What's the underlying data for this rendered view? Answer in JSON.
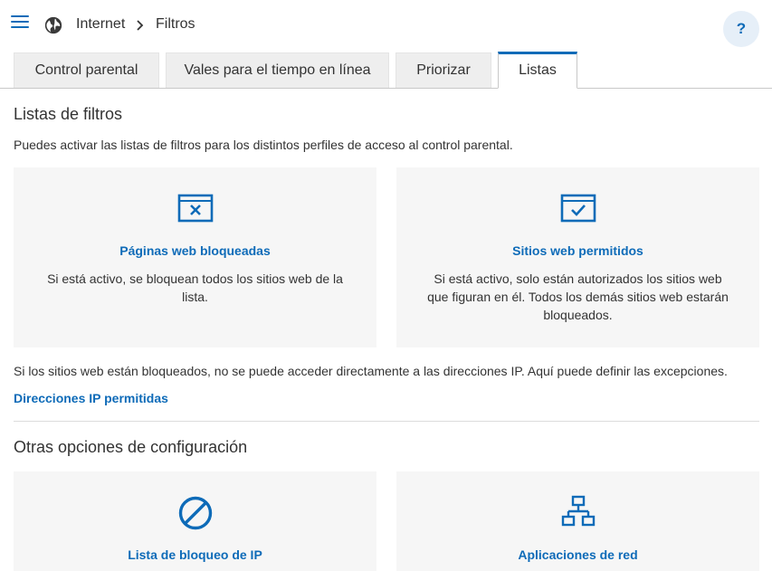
{
  "breadcrumb": {
    "parent": "Internet",
    "current": "Filtros"
  },
  "help": {
    "label": "?"
  },
  "tabs": [
    {
      "label": "Control parental"
    },
    {
      "label": "Vales para el tiempo en línea"
    },
    {
      "label": "Priorizar"
    },
    {
      "label": "Listas"
    }
  ],
  "filters": {
    "title": "Listas de filtros",
    "description": "Puedes activar las listas de filtros para los distintos perfiles de acceso al control parental.",
    "cards": [
      {
        "icon": "blocked-window-icon",
        "title": "Páginas web bloqueadas",
        "description": "Si está activo, se bloquean todos los sitios web de la lista."
      },
      {
        "icon": "allowed-window-icon",
        "title": "Sitios web permitidos",
        "description": "Si está activo, solo están autorizados los sitios web que figuran en él. Todos los demás sitios web estarán bloqueados."
      }
    ],
    "ip_note": "Si los sitios web están bloqueados, no se puede acceder directamente a las direcciones IP. Aquí puede definir las excepciones.",
    "ip_link": "Direcciones IP permitidas"
  },
  "other": {
    "title": "Otras opciones de configuración",
    "cards": [
      {
        "icon": "block-icon",
        "title": "Lista de bloqueo de IP"
      },
      {
        "icon": "network-icon",
        "title": "Aplicaciones de red"
      }
    ]
  },
  "colors": {
    "accent": "#0e6bb8",
    "card_bg": "#f6f6f6",
    "tab_bg": "#eeeeee"
  }
}
